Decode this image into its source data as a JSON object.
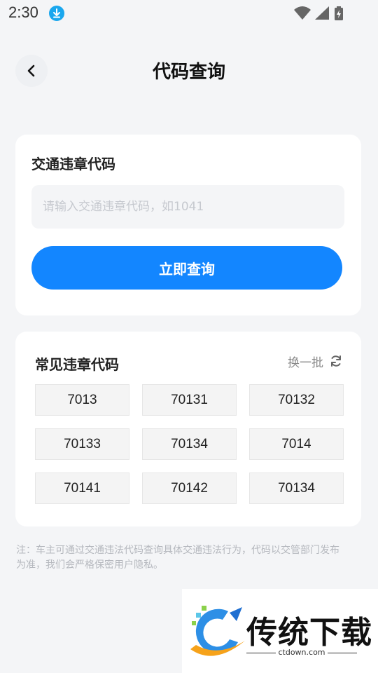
{
  "status_bar": {
    "time": "2:30",
    "icons": [
      "download-icon",
      "wifi-icon",
      "signal-icon",
      "battery-charging-icon"
    ]
  },
  "header": {
    "back_icon": "chevron-left-icon",
    "title": "代码查询"
  },
  "query_card": {
    "label": "交通违章代码",
    "input_value": "",
    "input_placeholder": "请输入交通违章代码，如1041",
    "button_label": "立即查询",
    "button_color": "#1386ff"
  },
  "common_card": {
    "title": "常见违章代码",
    "refresh_label": "换一批",
    "refresh_icon": "refresh-icon",
    "codes": [
      "7013",
      "70131",
      "70132",
      "70133",
      "70134",
      "7014",
      "70141",
      "70142",
      "70134"
    ]
  },
  "note": "注：车主可通过交通违法代码查询具体交通违法行为，代码以交管部门发布为准，我们会严格保密用户隐私。",
  "watermark": {
    "brand": "传统下载",
    "domain": "ctdown.com"
  }
}
